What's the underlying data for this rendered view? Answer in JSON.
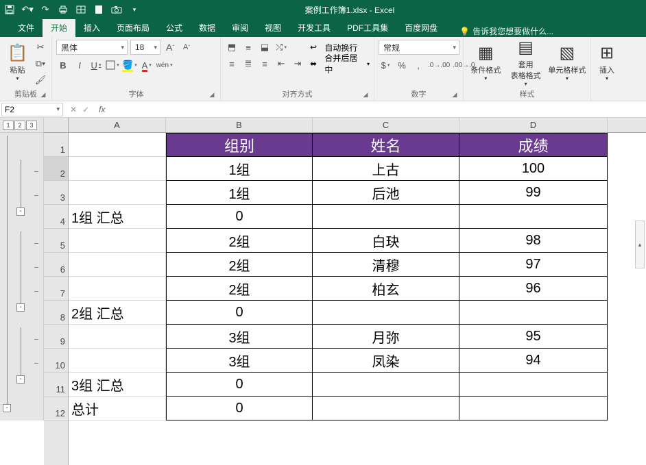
{
  "app": {
    "title": "案例工作簿1.xlsx - Excel"
  },
  "qat": {
    "save": "save-icon",
    "undo": "undo-icon",
    "redo": "redo-icon",
    "print": "print-icon",
    "table": "table-icon",
    "new": "new-icon",
    "camera": "camera-icon"
  },
  "tabs": {
    "items": [
      "文件",
      "开始",
      "插入",
      "页面布局",
      "公式",
      "数据",
      "审阅",
      "视图",
      "开发工具",
      "PDF工具集",
      "百度网盘"
    ],
    "active_index": 1,
    "tell_me": "告诉我您想要做什么..."
  },
  "ribbon": {
    "clipboard": {
      "label": "剪贴板",
      "paste": "粘贴"
    },
    "font": {
      "label": "字体",
      "name": "黑体",
      "size": "18",
      "inc": "A",
      "dec": "A"
    },
    "align": {
      "label": "对齐方式",
      "wrap": "自动换行",
      "merge": "合并后居中"
    },
    "number": {
      "label": "数字",
      "format": "常规"
    },
    "styles": {
      "label": "样式",
      "cond": "条件格式",
      "table": "套用\n表格格式",
      "cell": "单元格样式"
    },
    "insert": {
      "label": "",
      "btn": "插入"
    }
  },
  "formula_bar": {
    "name": "F2",
    "fx": "fx",
    "value": ""
  },
  "outline_levels": [
    "1",
    "2",
    "3"
  ],
  "columns": [
    "A",
    "B",
    "C",
    "D"
  ],
  "header_row": {
    "A": "",
    "B": "组别",
    "C": "姓名",
    "D": "成绩"
  },
  "rows": [
    {
      "n": "1",
      "A": "",
      "B": "组别",
      "C": "姓名",
      "D": "成绩",
      "is_header": true
    },
    {
      "n": "2",
      "A": "",
      "B": "1组",
      "C": "上古",
      "D": "100"
    },
    {
      "n": "3",
      "A": "",
      "B": "1组",
      "C": "后池",
      "D": "99"
    },
    {
      "n": "4",
      "A": "1组 汇总",
      "B": "0",
      "C": "",
      "D": ""
    },
    {
      "n": "5",
      "A": "",
      "B": "2组",
      "C": "白玦",
      "D": "98"
    },
    {
      "n": "6",
      "A": "",
      "B": "2组",
      "C": "清穆",
      "D": "97"
    },
    {
      "n": "7",
      "A": "",
      "B": "2组",
      "C": "柏玄",
      "D": "96"
    },
    {
      "n": "8",
      "A": "2组 汇总",
      "B": "0",
      "C": "",
      "D": ""
    },
    {
      "n": "9",
      "A": "",
      "B": "3组",
      "C": "月弥",
      "D": "95"
    },
    {
      "n": "10",
      "A": "",
      "B": "3组",
      "C": "凤染",
      "D": "94"
    },
    {
      "n": "11",
      "A": "3组 汇总",
      "B": "0",
      "C": "",
      "D": ""
    },
    {
      "n": "12",
      "A": "总计",
      "B": "0",
      "C": "",
      "D": ""
    }
  ],
  "row_headers": [
    "1",
    "2",
    "3",
    "4",
    "5",
    "6",
    "7",
    "8",
    "9",
    "10",
    "11",
    "12"
  ],
  "outline_minus": "-",
  "chart_data": {
    "type": "table",
    "columns": [
      "组别",
      "姓名",
      "成绩"
    ],
    "records": [
      [
        "1组",
        "上古",
        100
      ],
      [
        "1组",
        "后池",
        99
      ],
      [
        "2组",
        "白玦",
        98
      ],
      [
        "2组",
        "清穆",
        97
      ],
      [
        "2组",
        "柏玄",
        96
      ],
      [
        "3组",
        "月弥",
        95
      ],
      [
        "3组",
        "凤染",
        94
      ]
    ],
    "subtotals": [
      {
        "label": "1组 汇总",
        "value": 0
      },
      {
        "label": "2组 汇总",
        "value": 0
      },
      {
        "label": "3组 汇总",
        "value": 0
      },
      {
        "label": "总计",
        "value": 0
      }
    ]
  }
}
